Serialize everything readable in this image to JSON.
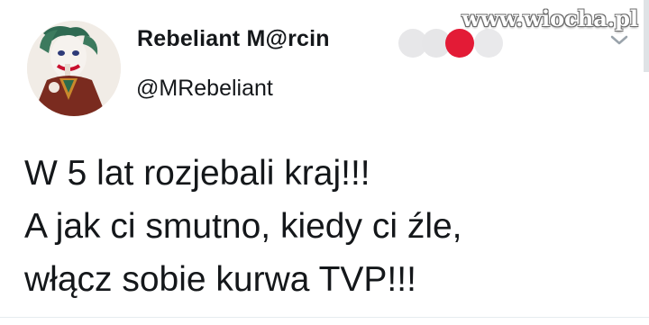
{
  "watermark": "www.wiocha.pl",
  "author": {
    "name": "Rebeliant M@rcin",
    "handle": "@MRebeliant",
    "avatar_icon": "joker-avatar"
  },
  "badge_dots": {
    "colors": [
      "#e7e7e9",
      "#e6e6e8",
      "#e31b36",
      "#e9e9eb"
    ]
  },
  "menu_icon": "chevron-down-icon",
  "tweet": {
    "lines": [
      "W 5 lat rozjebali kraj!!!",
      "A jak ci smutno, kiedy ci źle,",
      "włącz sobie kurwa TVP!!!"
    ]
  }
}
